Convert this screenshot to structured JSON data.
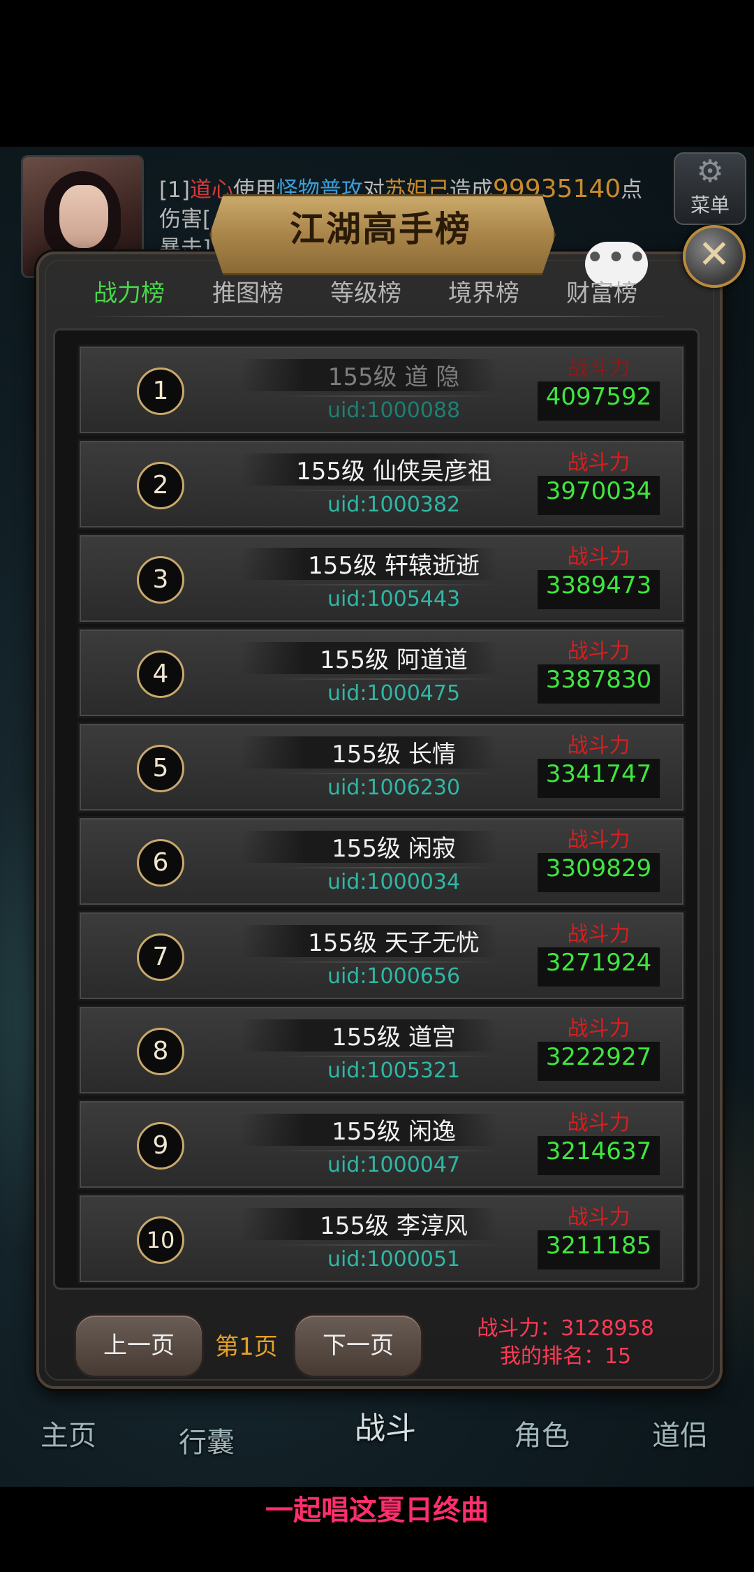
{
  "hud": {
    "battle_log": {
      "prefix": "[1]",
      "actor": "道心",
      "verb1": "使用",
      "skill": "怪物普攻",
      "verb2": "对",
      "target": "苏妲己",
      "verb3": "造成",
      "damage": "99935140",
      "suffix": "点伤害[",
      "line2": "暴击]"
    },
    "menu_label": "菜单"
  },
  "dialog": {
    "title": "江湖高手榜",
    "close_symbol": "✕",
    "chat_symbol": "•••",
    "tabs": [
      {
        "label": "战力榜",
        "active": true
      },
      {
        "label": "推图榜",
        "active": false
      },
      {
        "label": "等级榜",
        "active": false
      },
      {
        "label": "境界榜",
        "active": false
      },
      {
        "label": "财富榜",
        "active": false
      }
    ],
    "power_label": "战斗力",
    "ranks": [
      {
        "rank": "1",
        "name": "155级 道 隐",
        "uid": "uid:1000088",
        "power": "4097592"
      },
      {
        "rank": "2",
        "name": "155级 仙侠吴彦祖",
        "uid": "uid:1000382",
        "power": "3970034"
      },
      {
        "rank": "3",
        "name": "155级 轩辕逝逝",
        "uid": "uid:1005443",
        "power": "3389473"
      },
      {
        "rank": "4",
        "name": "155级 阿道道",
        "uid": "uid:1000475",
        "power": "3387830"
      },
      {
        "rank": "5",
        "name": "155级 长情",
        "uid": "uid:1006230",
        "power": "3341747"
      },
      {
        "rank": "6",
        "name": "155级 闲寂",
        "uid": "uid:1000034",
        "power": "3309829"
      },
      {
        "rank": "7",
        "name": "155级 天子无忧",
        "uid": "uid:1000656",
        "power": "3271924"
      },
      {
        "rank": "8",
        "name": "155级 道宫",
        "uid": "uid:1005321",
        "power": "3222927"
      },
      {
        "rank": "9",
        "name": "155级 闲逸",
        "uid": "uid:1000047",
        "power": "3214637"
      },
      {
        "rank": "10",
        "name": "155级 李淳风",
        "uid": "uid:1000051",
        "power": "3211185"
      }
    ],
    "footer": {
      "prev_label": "上一页",
      "page_label": "第1页",
      "next_label": "下一页",
      "my_power": "战斗力：3128958",
      "my_rank": "我的排名：15"
    }
  },
  "bottom_nav": [
    "主页",
    "行囊",
    "战斗",
    "角色",
    "道侣"
  ],
  "lyric": "一起唱这夏日终曲",
  "colors": {
    "tab_active": "#49d64a",
    "power_label": "#d42020",
    "power_value": "#3fe63f",
    "uid": "#2fb7a5",
    "page_num": "#e6a028",
    "my_rank": "#ff3a55",
    "lyric": "#ff2e6c"
  }
}
